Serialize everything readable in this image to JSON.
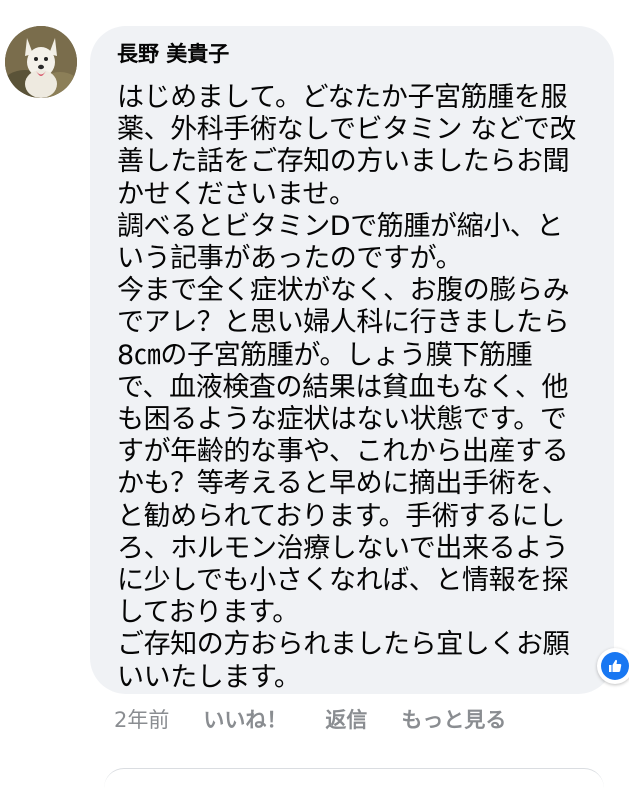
{
  "comment": {
    "author": "長野 美貴子",
    "body": "はじめまして。どなたか子宮筋腫を服\n薬、外科手術なしでビタミン などで改\n善した話をご存知の方いましたらお聞\nかせくださいませ。\n調べるとビタミンDで筋腫が縮小、と\nいう記事があったのですが。\n今まで全く症状がなく、お腹の膨らみ\nでアレ？と思い婦人科に行きましたら\n8㎝の子宮筋腫が。しょう膜下筋腫\nで、血液検査の結果は貧血もなく、他\nも困るような症状はない状態です。で\nすが年齢的な事や、これから出産する\nかも？等考えると早めに摘出手術を、\nと勧められております。手術するにし\nろ、ホルモン治療しないで出来るよう\nに少しでも小さくなれば、と情報を探\nしております。\nご存知の方おられましたら宜しくお願\nいいたします。",
    "avatar_icon": "dog-avatar-icon",
    "reaction_icon": "like-reaction-icon",
    "accent_color": "#1877f2",
    "bubble_color": "#f0f2f5"
  },
  "actions": {
    "time": "2年前",
    "like": "いいね！",
    "reply": "返信",
    "more": "もっと見る"
  }
}
